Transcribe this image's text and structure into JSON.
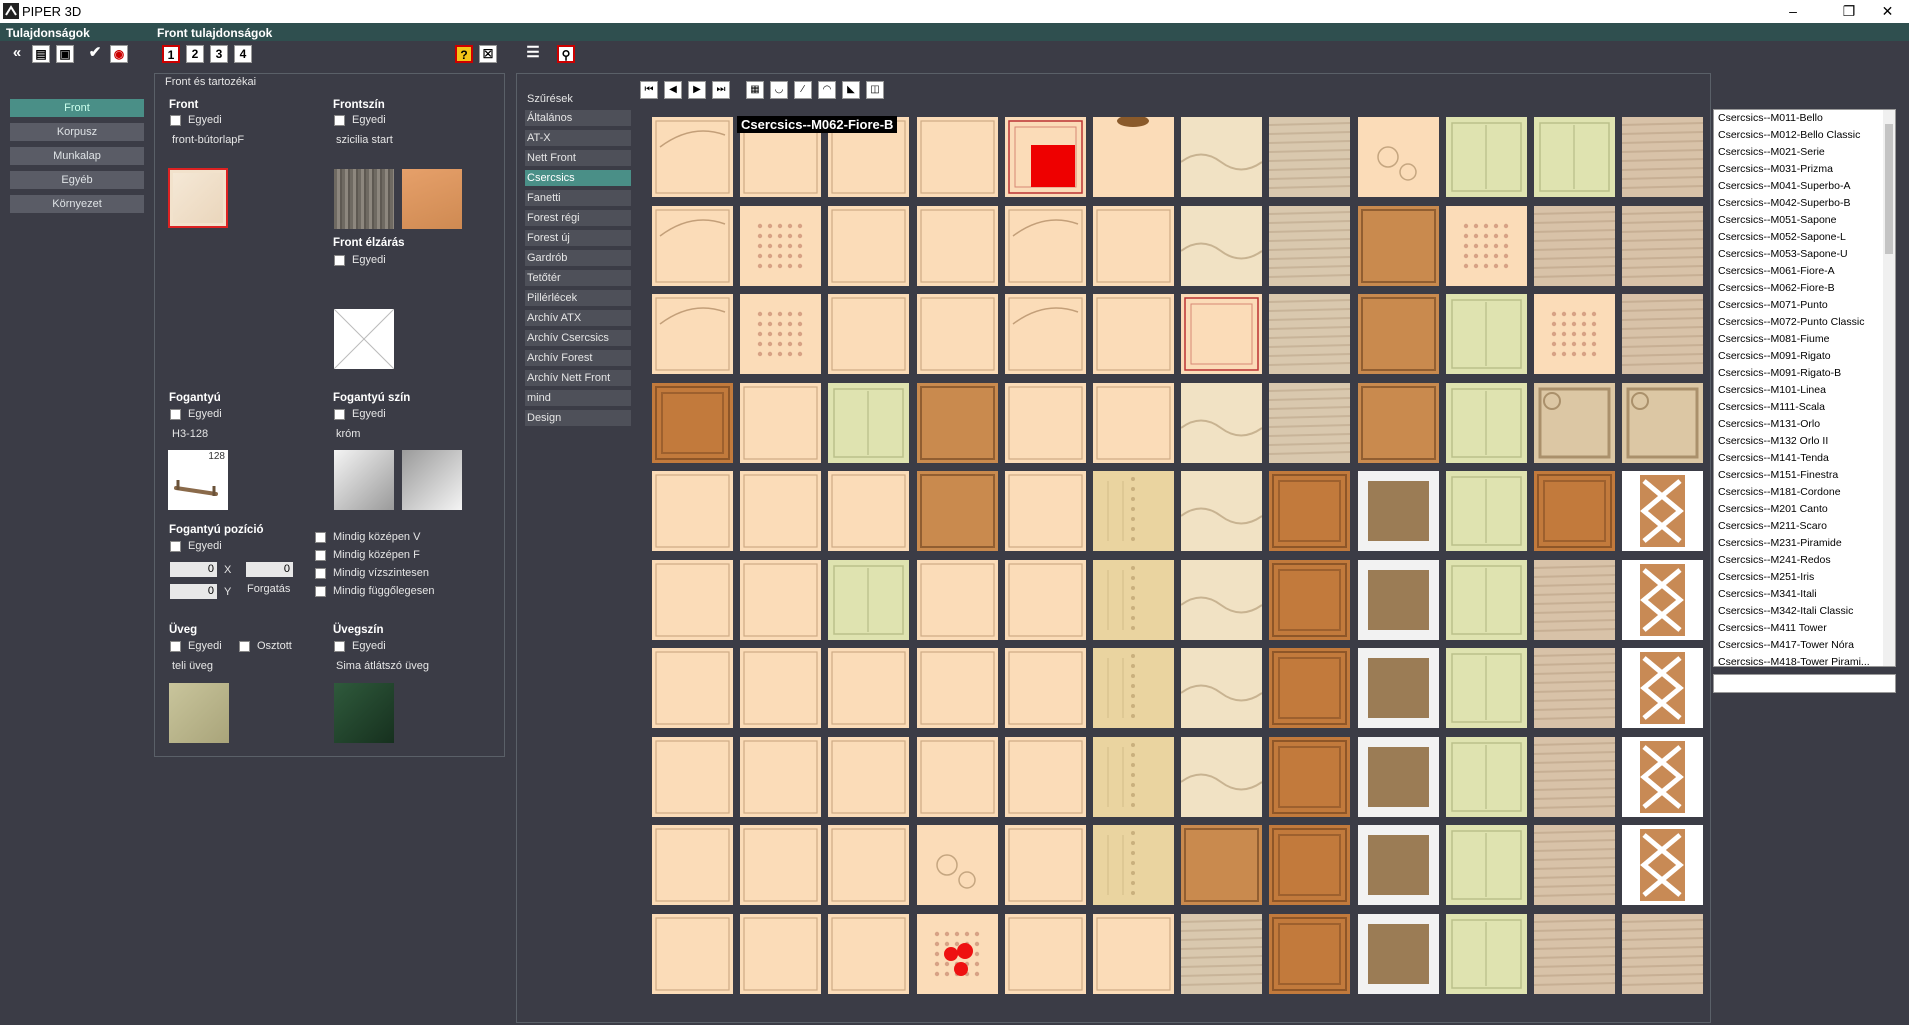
{
  "window": {
    "title": "PIPER 3D"
  },
  "headers": {
    "left": "Tulajdonságok",
    "main": "Front tulajdonságok"
  },
  "toolbar": {
    "numbers": [
      "1",
      "2",
      "3",
      "4"
    ]
  },
  "nav": [
    "Front",
    "Korpusz",
    "Munkalap",
    "Egyéb",
    "Környezet"
  ],
  "panel": {
    "title": "Front és tartozékai",
    "front": {
      "label": "Front",
      "egyedi": "Egyedi",
      "value": "front-bútorlapF"
    },
    "frontszin": {
      "label": "Frontszín",
      "egyedi": "Egyedi",
      "value": "szicilia start"
    },
    "frontelzaras": {
      "label": "Front élzárás",
      "egyedi": "Egyedi"
    },
    "fogantyu": {
      "label": "Fogantyú",
      "egyedi": "Egyedi",
      "value": "H3-128",
      "badge": "128"
    },
    "fogantyuszin": {
      "label": "Fogantyú szín",
      "egyedi": "Egyedi",
      "value": "króm"
    },
    "fogantyupozicio": {
      "label": "Fogantyú pozíció",
      "egyedi": "Egyedi",
      "x_value": "0",
      "y_value": "0",
      "rot_value": "0",
      "x": "X",
      "y": "Y",
      "forgatas": "Forgatás",
      "options": [
        "Mindig középen V",
        "Mindig középen F",
        "Mindig vízszintesen",
        "Mindig függőlegesen"
      ]
    },
    "uveg": {
      "label": "Üveg",
      "egyedi": "Egyedi",
      "osztott": "Osztott",
      "value": "teli üveg"
    },
    "uvegszin": {
      "label": "Üvegszín",
      "egyedi": "Egyedi",
      "value": "Sima átlátszó üveg"
    }
  },
  "filters": {
    "title": "Szűrések",
    "items": [
      "Általános",
      "AT-X",
      "Nett Front",
      "Csercsics",
      "Fanetti",
      "Forest régi",
      "Forest új",
      "Gardrób",
      "Tetőtér",
      "Pillérlécek",
      "Archív ATX",
      "Archív Csercsics",
      "Archív Forest",
      "Archív Nett Front",
      "mind",
      "Design"
    ],
    "active": "Csercsics"
  },
  "tooltip": "Csercsics--M062-Fiore-B",
  "list": [
    "Csercsics--M011-Bello",
    "Csercsics--M012-Bello Classic",
    "Csercsics--M021-Serie",
    "Csercsics--M031-Prizma",
    "Csercsics--M041-Superbo-A",
    "Csercsics--M042-Superbo-B",
    "Csercsics--M051-Sapone",
    "Csercsics--M052-Sapone-L",
    "Csercsics--M053-Sapone-U",
    "Csercsics--M061-Fiore-A",
    "Csercsics--M062-Fiore-B",
    "Csercsics--M071-Punto",
    "Csercsics--M072-Punto Classic",
    "Csercsics--M081-Fiume",
    "Csercsics--M091-Rigato",
    "Csercsics--M091-Rigato-B",
    "Csercsics--M101-Linea",
    "Csercsics--M111-Scala",
    "Csercsics--M131-Orlo",
    "Csercsics--M132 Orlo II",
    "Csercsics--M141-Tenda",
    "Csercsics--M151-Finestra",
    "Csercsics--M181-Cordone",
    "Csercsics--M201 Canto",
    "Csercsics--M211-Scaro",
    "Csercsics--M231-Piramide",
    "Csercsics--M241-Redos",
    "Csercsics--M251-Iris",
    "Csercsics--M341-Itali",
    "Csercsics--M342-Itali Classic",
    "Csercsics--M411 Tower",
    "Csercsics--M417-Tower Nóra",
    "Csercsics--M418-Tower Pirami..."
  ],
  "colors": {
    "accent": "#4a8f87",
    "background": "#3b3c46",
    "cream": "#fbdcb8",
    "wood": "#c07838",
    "sage": "#dfe3b0",
    "oak": "#d8c2a8"
  }
}
